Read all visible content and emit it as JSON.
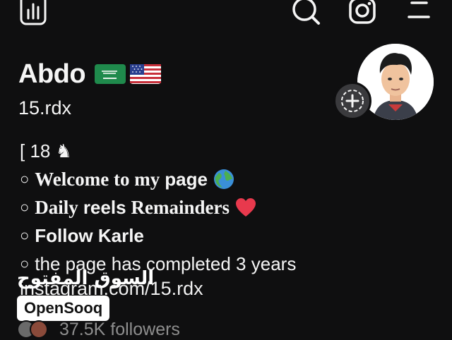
{
  "header": {
    "icons": [
      "stats-icon",
      "search-icon",
      "instagram-icon",
      "menu-icon"
    ]
  },
  "profile": {
    "name": "Abdo",
    "flags": [
      "saudi-flag-icon",
      "us-flag-icon"
    ],
    "username": "15.rdx"
  },
  "bio": {
    "line1": "[ 18 ♞",
    "line2_a": "Welcome to my",
    "line2_b": "page",
    "line3_a": "Daily",
    "line3_b": "reels",
    "line3_c": "Remainders",
    "line4": "Follow Karle",
    "line5": "the page has completed 3 years",
    "bullet": "○",
    "link": "instagram.com/15.rdx"
  },
  "followers": {
    "label": "37.5K followers"
  },
  "watermark": {
    "arabic": "السوق المفتوح",
    "brand": "OpenSooq"
  },
  "colors": {
    "background": "#0f0f10",
    "text": "#f5f5f5",
    "muted": "#8e8e8e",
    "heart": "#e8394d"
  }
}
